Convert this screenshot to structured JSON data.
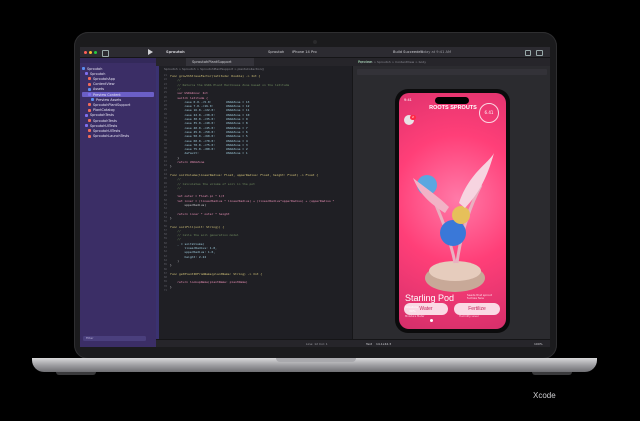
{
  "caption": "Xcode",
  "toolbar": {
    "project": "Sproutoh",
    "scheme": "Sproutoh",
    "device": "iPhone 14 Pro",
    "status": "Build Succeeded",
    "status_time": "Today at 9:41 AM"
  },
  "tabs": {
    "active": "SproutohPlantSupport",
    "breadcrumb": "Sproutoh > Sproutoh > SproutohPlantSupport > plantsCollection()",
    "canvas_crumb": "Sproutoh > Sproutoh > ContentView > body",
    "preview_label": "Preview"
  },
  "navigator": {
    "items": [
      {
        "label": "Sproutoh",
        "color": "#5b8def"
      },
      {
        "label": "Sproutoh",
        "color": "#7f6ff0"
      },
      {
        "label": "SproutohApp",
        "color": "#ef6a5b"
      },
      {
        "label": "ContentView",
        "color": "#ef6a5b"
      },
      {
        "label": "Assets",
        "color": "#5b8def"
      },
      {
        "label": "Preview Content",
        "color": "#7f6ff0"
      },
      {
        "label": "Preview Assets",
        "color": "#5b8def"
      },
      {
        "label": "SproutohPlantSupport",
        "color": "#ef6a5b"
      },
      {
        "label": "PlantCatalog",
        "color": "#ef6a5b"
      },
      {
        "label": "SproutohTests",
        "color": "#7f6ff0"
      },
      {
        "label": "SproutohTests",
        "color": "#ef6a5b"
      },
      {
        "label": "SproutohUITests",
        "color": "#7f6ff0"
      },
      {
        "label": "SproutohUITests",
        "color": "#ef6a5b"
      },
      {
        "label": "SproutohLaunchTests",
        "color": "#ef6a5b"
      }
    ],
    "filter_placeholder": "Filter"
  },
  "code": [
    {
      "n": "21",
      "t": "func growthStressFactor(latitude: Double) -> Int {",
      "c": "#d9c97c"
    },
    {
      "n": "22",
      "t": "    //",
      "c": "#6f8b5e"
    },
    {
      "n": "23",
      "t": "    // Returns the USDA Plant Hardiness Zone based on the latitude",
      "c": "#6f8b5e"
    },
    {
      "n": "24",
      "t": "    //",
      "c": "#6f8b5e"
    },
    {
      "n": "25",
      "t": "    var USDAZone: Int",
      "c": "#e88fb5"
    },
    {
      "n": "26",
      "t": "    switch latitude {",
      "c": "#e88fb5"
    },
    {
      "n": "27",
      "t": "        case 0.0..<5.0:        USDAZone = 13",
      "c": "#a0cfe0"
    },
    {
      "n": "28",
      "t": "        case 7.0..<16.0:       USDAZone = 12",
      "c": "#a0cfe0"
    },
    {
      "n": "29",
      "t": "        case 16.0..<22.0:      USDAZone = 11",
      "c": "#a0cfe0"
    },
    {
      "n": "30",
      "t": "        case 22.0..<30.0:      USDAZone = 10",
      "c": "#a0cfe0"
    },
    {
      "n": "31",
      "t": "        case 30.0..<35.0:      USDAZone = 9",
      "c": "#a0cfe0"
    },
    {
      "n": "32",
      "t": "        case 35.0..<40.0:      USDAZone = 8",
      "c": "#a0cfe0"
    },
    {
      "n": "33",
      "t": "        case 40.0..<45.0:      USDAZone = 7",
      "c": "#a0cfe0"
    },
    {
      "n": "34",
      "t": "        case 45.0..<50.0:      USDAZone = 6",
      "c": "#a0cfe0"
    },
    {
      "n": "35",
      "t": "        case 50.0..<60.0:      USDAZone = 5",
      "c": "#a0cfe0"
    },
    {
      "n": "36",
      "t": "        case 60.0..<70.0:      USDAZone = 4",
      "c": "#a0cfe0"
    },
    {
      "n": "37",
      "t": "        case 70.0..<75.0:      USDAZone = 3",
      "c": "#a0cfe0"
    },
    {
      "n": "38",
      "t": "        case 75.0..<80.0:      USDAZone = 2",
      "c": "#a0cfe0"
    },
    {
      "n": "39",
      "t": "        default:               USDAZone = 1",
      "c": "#a0cfe0"
    },
    {
      "n": "40",
      "t": "    }",
      "c": "#cfcfd4"
    },
    {
      "n": "41",
      "t": "    return USDAZone",
      "c": "#e88fb5"
    },
    {
      "n": "42",
      "t": "}",
      "c": "#cfcfd4"
    },
    {
      "n": "43",
      "t": "",
      "c": "#cfcfd4"
    },
    {
      "n": "44",
      "t": "func soilVolume(linearRadius: Float, upperRadius: Float, height: Float) -> Float {",
      "c": "#d9c97c"
    },
    {
      "n": "45",
      "t": "    //",
      "c": "#6f8b5e"
    },
    {
      "n": "46",
      "t": "    // Calculates the volume of soil in the pot",
      "c": "#6f8b5e"
    },
    {
      "n": "47",
      "t": "    //",
      "c": "#6f8b5e"
    },
    {
      "n": "48",
      "t": "",
      "c": "#cfcfd4"
    },
    {
      "n": "49",
      "t": "    let outer = Float.pi * 1/3",
      "c": "#e88fb5"
    },
    {
      "n": "50",
      "t": "    let inner = (linearRadius * linearRadius) + (linearRadius*upperRadius) + (upperRadius *",
      "c": "#e88fb5"
    },
    {
      "n": "51",
      "t": "        upperRadius)",
      "c": "#cfcfd4"
    },
    {
      "n": "52",
      "t": "",
      "c": "#cfcfd4"
    },
    {
      "n": "53",
      "t": "    return inner * outer * height",
      "c": "#e88fb5"
    },
    {
      "n": "54",
      "t": "}",
      "c": "#cfcfd4"
    },
    {
      "n": "55",
      "t": "",
      "c": "#cfcfd4"
    },
    {
      "n": "56",
      "t": "func soilFill(unit: String)) {",
      "c": "#d9c97c"
    },
    {
      "n": "57",
      "t": "    //",
      "c": "#6f8b5e"
    },
    {
      "n": "58",
      "t": "    // Calls the soil generation model",
      "c": "#6f8b5e"
    },
    {
      "n": "59",
      "t": "    //",
      "c": "#6f8b5e"
    },
    {
      "n": "60",
      "t": "    _ = soilVolume(",
      "c": "#a0cfe0"
    },
    {
      "n": "61",
      "t": "        linearRadius: 1.0,",
      "c": "#a0cfe0"
    },
    {
      "n": "62",
      "t": "        upperRadius: 1.6,",
      "c": "#a0cfe0"
    },
    {
      "n": "63",
      "t": "        height: 2.22",
      "c": "#a0cfe0"
    },
    {
      "n": "64",
      "t": "    )",
      "c": "#cfcfd4"
    },
    {
      "n": "65",
      "t": "}",
      "c": "#cfcfd4"
    },
    {
      "n": "66",
      "t": "",
      "c": "#cfcfd4"
    },
    {
      "n": "67",
      "t": "func getPlantIDFromName(plantName: String) -> Int {",
      "c": "#d9c97c"
    },
    {
      "n": "68",
      "t": "",
      "c": "#cfcfd4"
    },
    {
      "n": "69",
      "t": "    return lookupName(plantName: plantName)",
      "c": "#e88fb5"
    },
    {
      "n": "70",
      "t": "}",
      "c": "#cfcfd4"
    },
    {
      "n": "71",
      "t": "",
      "c": "#cfcfd4"
    }
  ],
  "phone": {
    "time": "9:41",
    "logo": "ROOTS SPROUTS",
    "temp": "6.41",
    "badge": "2",
    "plant_name": "Starling Pod",
    "plant_desc": "Seeds that sprout fuchsia fans",
    "moisture_label": "Moisture",
    "moisture_value": "30%",
    "stat_left": "Moisture Meter",
    "stat_right": "Humidity Level",
    "water_label": "Water",
    "fertilize_label": "Fertilize"
  },
  "bottombar": {
    "text_label": "Text",
    "text_value": "14.1x42.3",
    "zoom": "100%",
    "cursor": "Line: 12  Col: 1"
  },
  "colors": {
    "accent": "#6b5fc7",
    "phone_bg": "#ff3f78"
  }
}
